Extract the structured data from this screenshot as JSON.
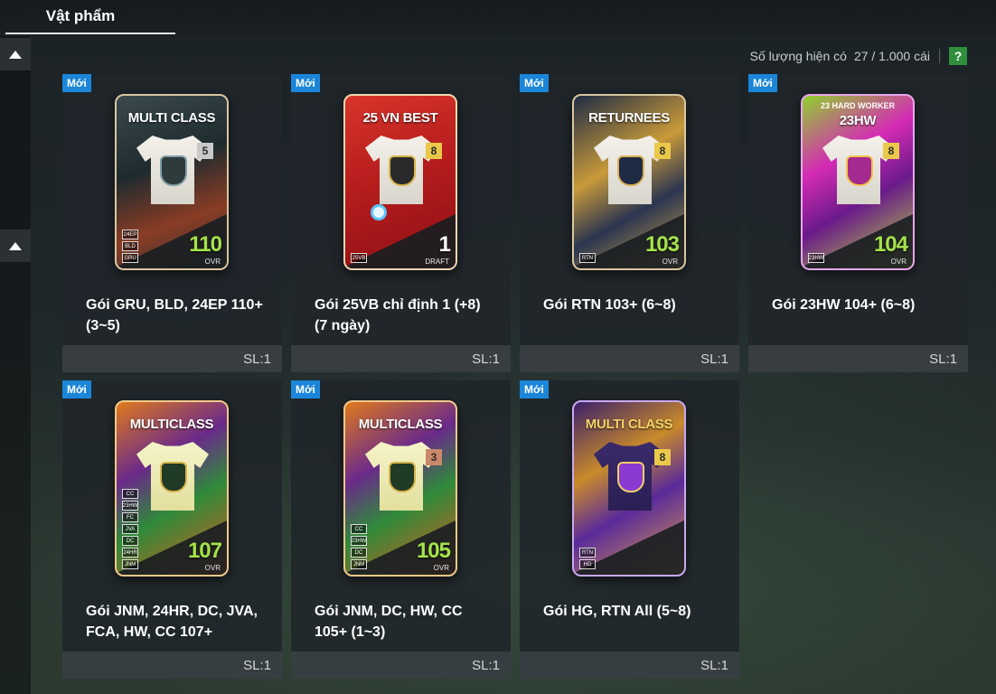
{
  "tabs": [
    {
      "label": "Vật phẩm",
      "active": true
    }
  ],
  "inventory": {
    "count_label": "Số lượng hiện có",
    "count_value": "27 / 1.000 cái",
    "help_label": "?"
  },
  "items": [
    {
      "badge": "Mới",
      "card_title": "MULTI CLASS",
      "card_subtitle": "",
      "level": "5",
      "ovr": "110",
      "ovr_label": "OVR",
      "tags": [
        "24EP",
        "BLD",
        "GRU"
      ],
      "name": "Gói GRU, BLD, 24EP 110+ (3~5)",
      "qty": "SL:1",
      "theme": "multiclass-dark"
    },
    {
      "badge": "Mới",
      "card_title": "25 VN BEST",
      "card_subtitle": "",
      "level": "8",
      "ovr": "1",
      "ovr_label": "DRAFT",
      "tags": [
        "25VB"
      ],
      "name": "Gói 25VB chỉ định 1 (+8) (7 ngày)",
      "qty": "SL:1",
      "theme": "vnbest"
    },
    {
      "badge": "Mới",
      "card_title": "RETURNEES",
      "card_subtitle": "",
      "level": "8",
      "ovr": "103",
      "ovr_label": "OVR",
      "tags": [
        "RTN"
      ],
      "name": "Gói RTN 103+ (6~8)",
      "qty": "SL:1",
      "theme": "returnees"
    },
    {
      "badge": "Mới",
      "card_title": "23HW",
      "card_subtitle": "23 HARD WORKER",
      "level": "8",
      "ovr": "104",
      "ovr_label": "OVR",
      "tags": [
        "23HW"
      ],
      "name": "Gói 23HW 104+ (6~8)",
      "qty": "SL:1",
      "theme": "hardworker"
    },
    {
      "badge": "Mới",
      "card_title": "MULTICLASS",
      "card_subtitle": "",
      "level": "",
      "ovr": "107",
      "ovr_label": "OVR",
      "tags": [
        "CC",
        "23HW",
        "FC",
        "JVA",
        "DC",
        "24HR",
        "JNM"
      ],
      "name": "Gói JNM, 24HR, DC, JVA, FCA, HW, CC 107+",
      "qty": "SL:1",
      "theme": "multiclass-green"
    },
    {
      "badge": "Mới",
      "card_title": "MULTICLASS",
      "card_subtitle": "",
      "level": "3",
      "ovr": "105",
      "ovr_label": "OVR",
      "tags": [
        "CC",
        "23HW",
        "DC",
        "JNM"
      ],
      "name": "Gói JNM, DC, HW, CC 105+ (1~3)",
      "qty": "SL:1",
      "theme": "multiclass-green"
    },
    {
      "badge": "Mới",
      "card_title": "MULTI CLASS",
      "card_subtitle": "",
      "level": "8",
      "ovr": "",
      "ovr_label": "",
      "tags": [
        "RTN",
        "HG"
      ],
      "name": "Gói HG, RTN All (5~8)",
      "qty": "SL:1",
      "theme": "multiclass-purple"
    }
  ],
  "colors": {
    "accent_new": "#1b86d9",
    "ovr_green": "#a4e34a",
    "help_green": "#2f8f3c"
  },
  "icons": {
    "scroll_up": "triangle-up-icon",
    "help": "question-icon",
    "timer": "stopwatch-icon",
    "crest": "crest-icon",
    "jersey": "jersey-icon"
  }
}
